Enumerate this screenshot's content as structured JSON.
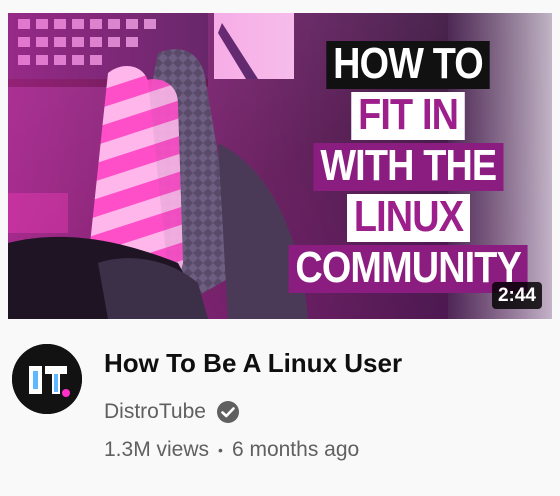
{
  "video": {
    "thumbnail_lines": [
      "HOW TO",
      "FIT IN",
      "WITH THE",
      "LINUX",
      "COMMUNITY"
    ],
    "duration": "2:44",
    "title": "How To Be A Linux User",
    "channel": "DistroTube",
    "views": "1.3M views",
    "separator": "•",
    "age": "6 months ago"
  },
  "colors": {
    "thumbnail_text_accent": "#9c1f8c",
    "meta_text": "#606060",
    "title_text": "#0f0f0f"
  }
}
